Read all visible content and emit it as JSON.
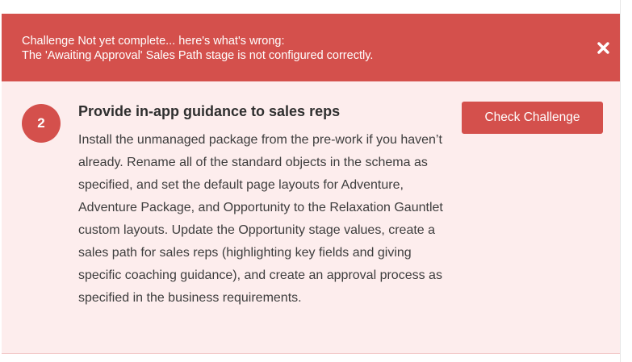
{
  "alert": {
    "line1": "Challenge Not yet complete... here's what's wrong:",
    "line2": "The 'Awaiting Approval' Sales Path stage is not configured correctly.",
    "close_icon": "close-icon",
    "background_color": "#d4504c"
  },
  "step": {
    "number": "2",
    "title": "Provide in-app guidance to sales reps",
    "description": "Install the unmanaged package from the pre-work if you haven’t already. Rename all of the standard objects in the schema as specified, and set the default page layouts for Adventure, Adventure Package, and Opportunity to the Relaxation Gauntlet custom layouts. Update the Opportunity stage values, create a sales path for sales reps (highlighting key fields and giving specific coaching guidance), and create an approval process as specified in the business requirements.",
    "check_button_label": "Check Challenge",
    "card_background": "#fdeded",
    "accent_color": "#d4504c"
  }
}
